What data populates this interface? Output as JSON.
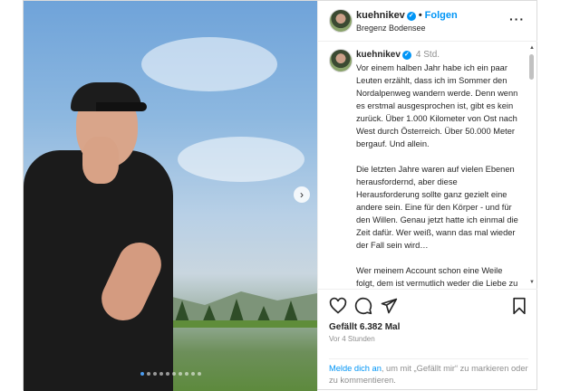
{
  "post": {
    "username": "kuehnikev",
    "follow_label": "Folgen",
    "location": "Bregenz Bodensee",
    "caption_time": "4 Std.",
    "caption_text": "Vor einem halben Jahr habe ich ein paar Leuten erzählt, dass ich im Sommer den Nordalpenweg wandern werde. Denn wenn es erstmal ausgesprochen ist, gibt es kein zurück. Über 1.000 Kilometer von Ost nach West durch Österreich. Über 50.000 Meter bergauf. Und allein.\n\nDie letzten Jahre waren auf vielen Ebenen herausfordernd, aber diese Herausforderung sollte ganz gezielt eine andere sein. Eine für den Körper - und für den Willen. Genau jetzt hatte ich einmal die Zeit dafür. Wer weiß, wann das mal wieder der Fall sein wird…\n\nWer meinem Account schon eine Weile folgt, dem ist vermutlich weder die Liebe zu den Bergen entgangen, noch ein gewisser Crush auf Österreich. All",
    "likes": "Gefällt 6.382 Mal",
    "posted_ago": "Vor 4 Stunden",
    "login_link": "Melde dich an",
    "login_rest": ", um mit „Gefällt mir“ zu markieren oder zu kommentieren."
  },
  "icons": {
    "verified": "verified-badge-icon",
    "more": "more-options-icon",
    "like": "heart-icon",
    "comment": "comment-icon",
    "share": "share-icon",
    "save": "bookmark-icon",
    "next": "chevron-right-icon"
  },
  "carousel": {
    "count": 10,
    "active": 1
  },
  "colors": {
    "accent": "#0095f6",
    "text": "#262626",
    "muted": "#8e8e8e"
  }
}
